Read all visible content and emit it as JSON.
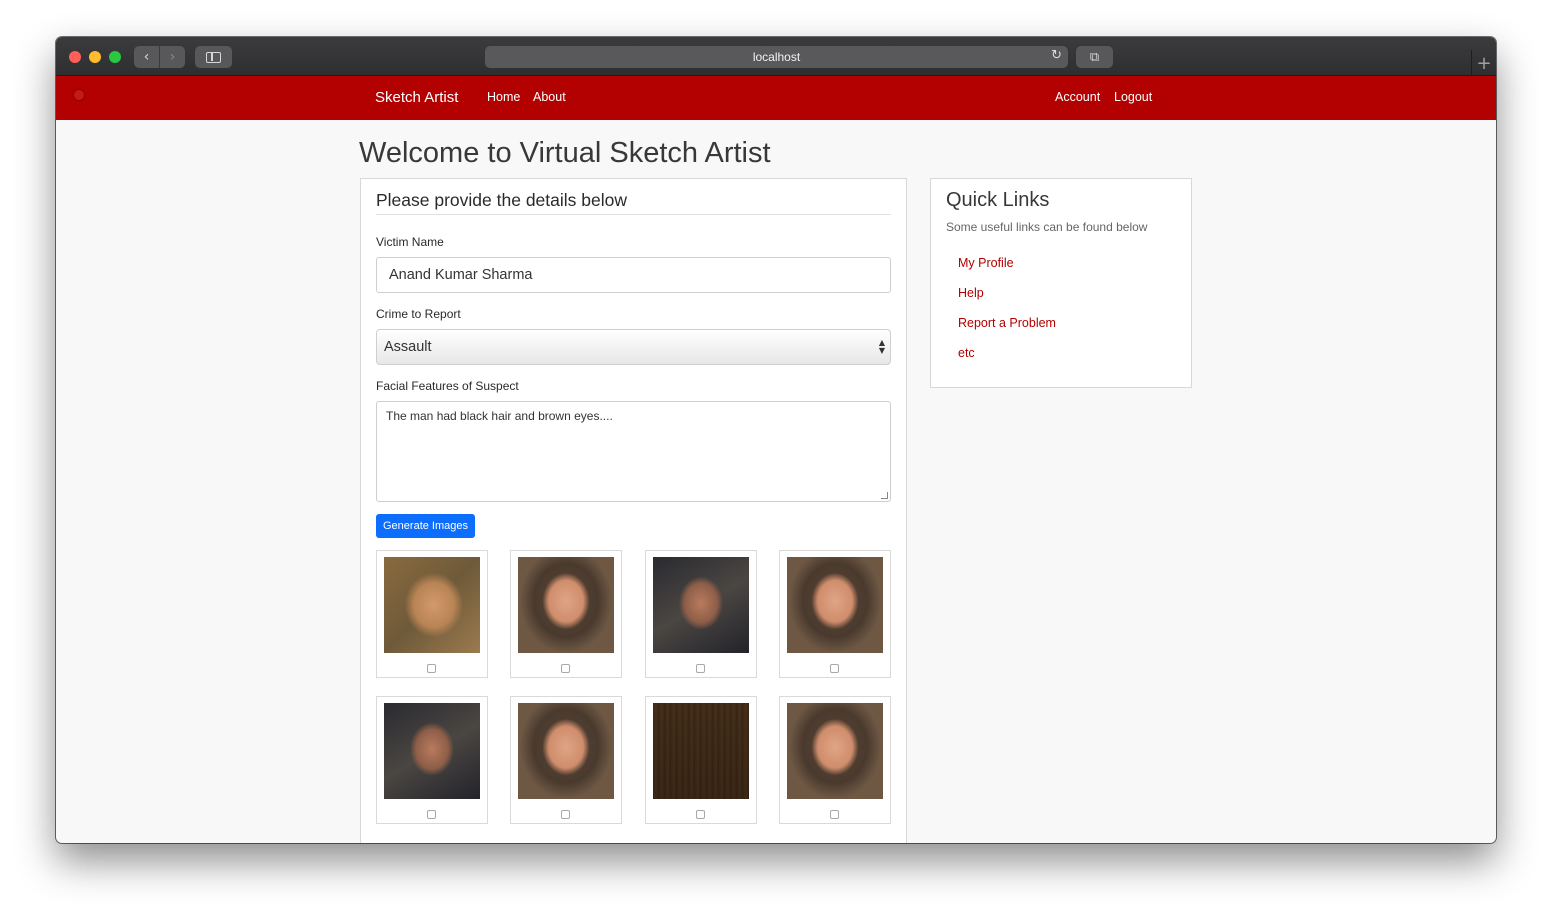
{
  "browser": {
    "url": "localhost"
  },
  "navbar": {
    "brand": "Sketch Artist",
    "links": [
      "Home",
      "About"
    ],
    "right_links": [
      "Account",
      "Logout"
    ],
    "color": "#b30000"
  },
  "page": {
    "title": "Welcome to Virtual Sketch Artist"
  },
  "form": {
    "heading": "Please provide the details below",
    "victim_label": "Victim Name",
    "victim_value": "Anand Kumar Sharma",
    "crime_label": "Crime to Report",
    "crime_value": "Assault",
    "features_label": "Facial Features of Suspect",
    "features_value": "The man had black hair and brown eyes....",
    "generate_button": "Generate Images",
    "button_color": "#0d6efd"
  },
  "generated_images": [
    {
      "kind": "blurry-face",
      "selected": false
    },
    {
      "kind": "hooded-face",
      "selected": false
    },
    {
      "kind": "dark-face",
      "selected": false
    },
    {
      "kind": "hooded-face",
      "selected": false
    },
    {
      "kind": "dark-face",
      "selected": false
    },
    {
      "kind": "hooded-face",
      "selected": false
    },
    {
      "kind": "noise",
      "selected": false
    },
    {
      "kind": "hooded-face",
      "selected": false
    }
  ],
  "quick_links": {
    "heading": "Quick Links",
    "subtitle": "Some useful links can be found below",
    "links": [
      "My Profile",
      "Help",
      "Report a Problem",
      "etc"
    ],
    "color": "#b30000"
  }
}
